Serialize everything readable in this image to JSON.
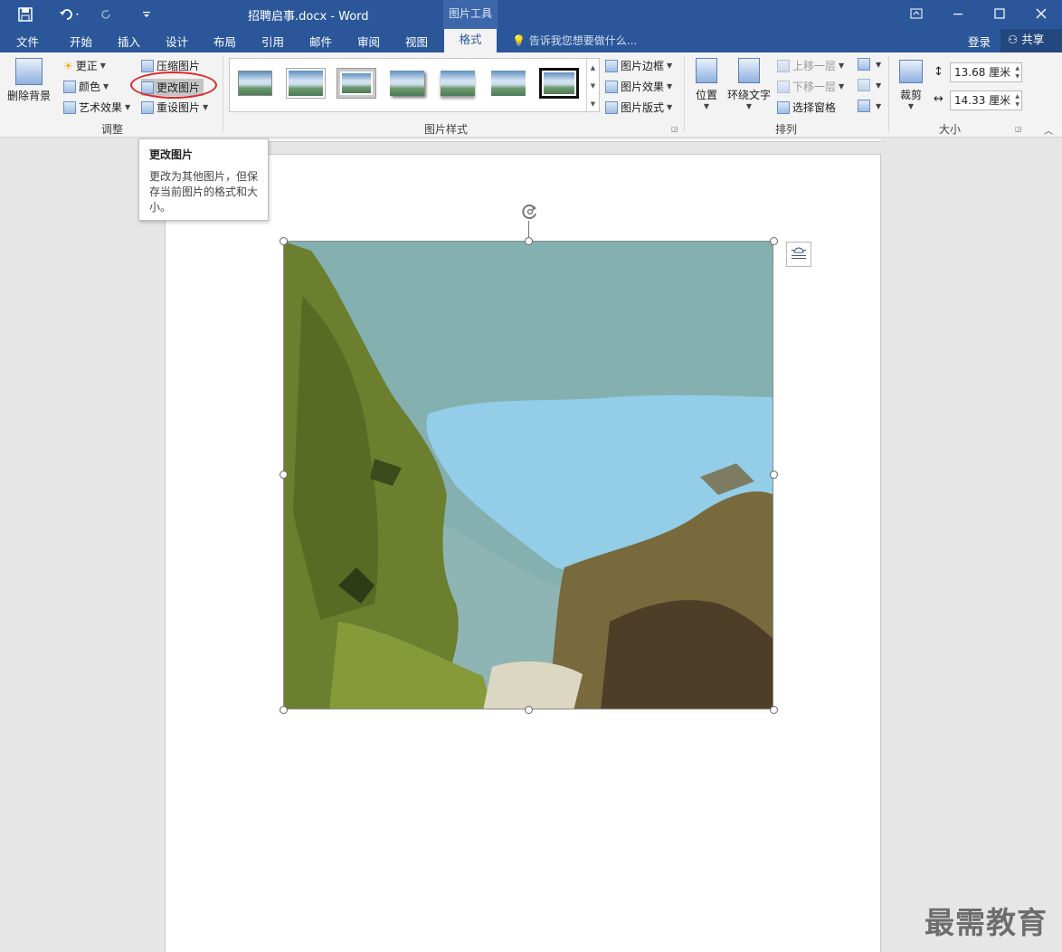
{
  "titlebar": {
    "document_title": "招聘启事.docx - Word",
    "context_tools_label": "图片工具",
    "icons": [
      "save-icon",
      "undo-icon",
      "redo-icon",
      "customize-qat-icon",
      "ribbon-display-icon",
      "minimize-icon",
      "maximize-icon",
      "close-icon"
    ]
  },
  "tabs": {
    "file": "文件",
    "home": "开始",
    "insert": "插入",
    "design": "设计",
    "layout": "布局",
    "references": "引用",
    "mailings": "邮件",
    "review": "审阅",
    "view": "视图",
    "format": "格式",
    "tell_me": "告诉我您想要做什么...",
    "login": "登录",
    "share": "共享"
  },
  "ribbon": {
    "adjust": {
      "group_label": "调整",
      "remove_background": "删除背景",
      "corrections": "更正",
      "color": "颜色",
      "artistic_effects": "艺术效果",
      "compress_pictures": "压缩图片",
      "change_picture": "更改图片",
      "reset_picture": "重设图片"
    },
    "picture_styles": {
      "group_label": "图片样式",
      "picture_border": "图片边框",
      "picture_effects": "图片效果",
      "picture_layout": "图片版式",
      "style_count": 7,
      "selected_style_index": 2
    },
    "arrange": {
      "group_label": "排列",
      "position": "位置",
      "wrap_text": "环绕文字",
      "bring_forward": "上移一层",
      "send_backward": "下移一层",
      "selection_pane": "选择窗格"
    },
    "size": {
      "group_label": "大小",
      "crop": "裁剪",
      "height": "13.68 厘米",
      "width": "14.33 厘米"
    }
  },
  "tooltip": {
    "title": "更改图片",
    "body": "更改为其他图片，但保存当前图片的格式和大小。"
  },
  "watermark": "最需教育",
  "colors": {
    "brand": "#2b579a",
    "highlight": "#e0262a"
  }
}
